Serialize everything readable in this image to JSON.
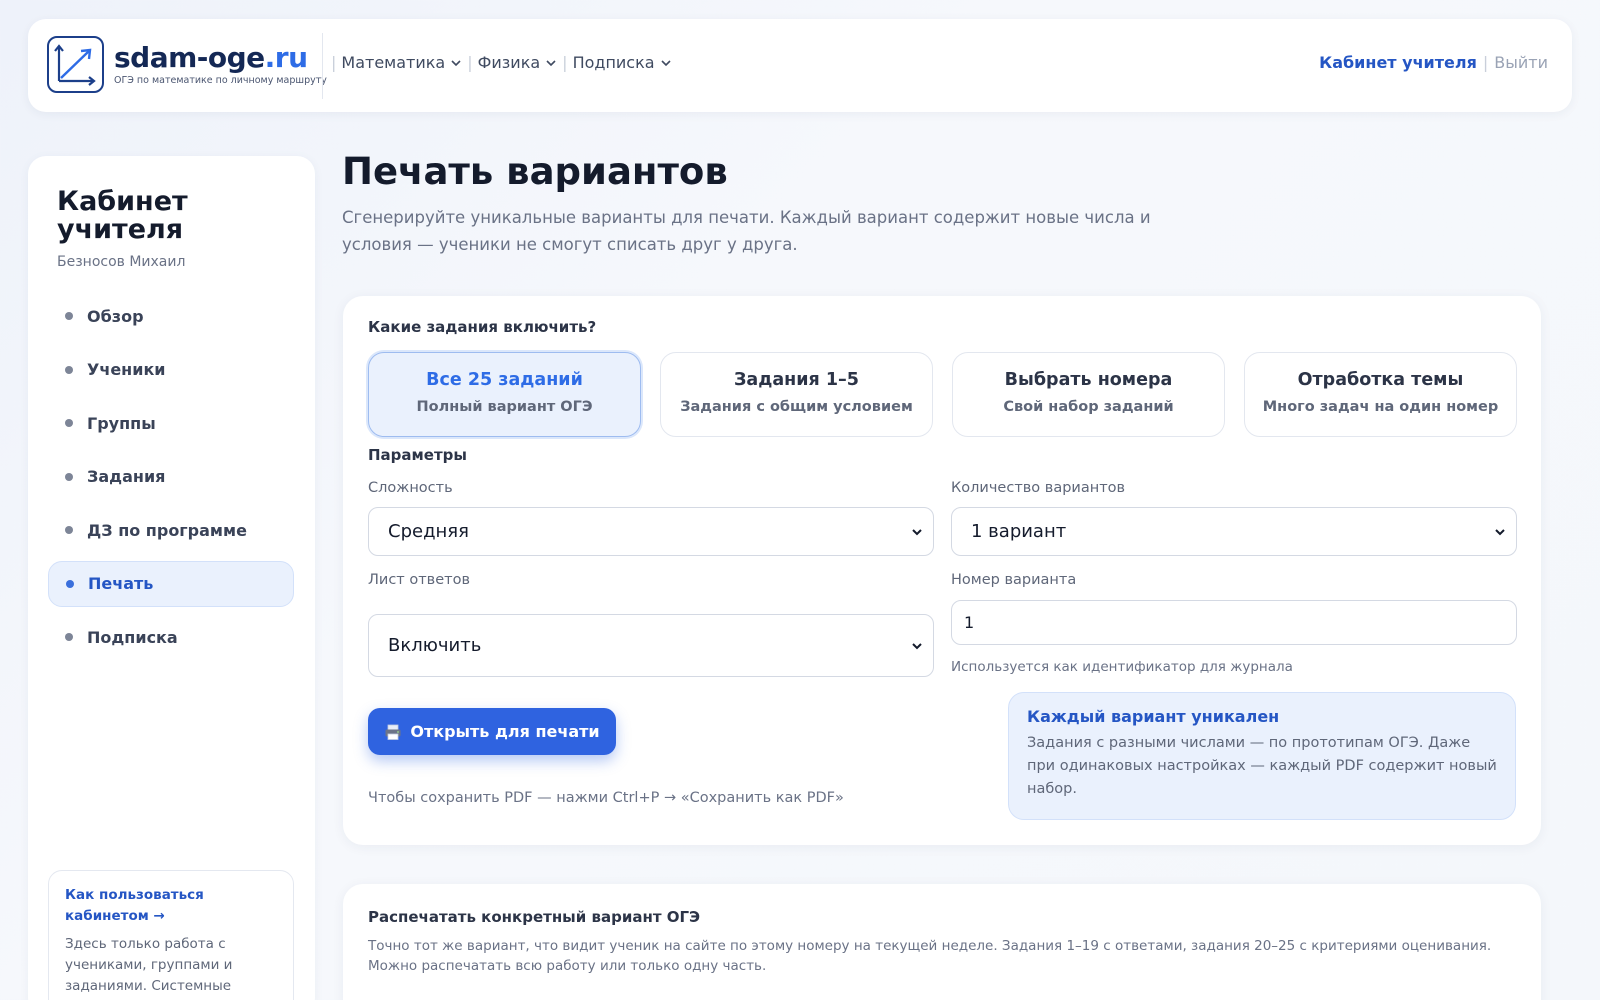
{
  "header": {
    "brand_name": "sdam-oge",
    "brand_tld": ".ru",
    "brand_sub": "ОГЭ по математике по личному маршруту",
    "nav": [
      {
        "label": "Математика"
      },
      {
        "label": "Физика"
      },
      {
        "label": "Подписка"
      }
    ],
    "cabinet_label": "Кабинет учителя",
    "logout_label": "Выйти",
    "accent_color": "#2556c4"
  },
  "sidebar": {
    "title": "Кабинет учителя",
    "user": "Безносов Михаил",
    "items": [
      {
        "label": "Обзор"
      },
      {
        "label": "Ученики"
      },
      {
        "label": "Группы"
      },
      {
        "label": "Задания"
      },
      {
        "label": "ДЗ по программе"
      },
      {
        "label": "Печать",
        "active": true
      },
      {
        "label": "Подписка"
      }
    ],
    "help": {
      "link": "Как пользоваться кабинетом →",
      "text": "Здесь только работа с учениками, группами и заданиями. Системные"
    }
  },
  "main": {
    "title": "Печать вариантов",
    "description": "Сгенерируйте уникальные варианты для печати. Каждый вариант содержит новые числа и условия — ученики не смогут списать друг у друга.",
    "tasks_label": "Какие задания включить?",
    "modes": [
      {
        "title": "Все 25 заданий",
        "sub": "Полный вариант ОГЭ",
        "active": true
      },
      {
        "title": "Задания 1–5",
        "sub": "Задания с общим условием"
      },
      {
        "title": "Выбрать номера",
        "sub": "Свой набор заданий"
      },
      {
        "title": "Отработка темы",
        "sub": "Много задач на один номер"
      }
    ],
    "params_label": "Параметры",
    "difficulty": {
      "label": "Сложность",
      "value": "Средняя"
    },
    "variants_count": {
      "label": "Количество вариантов",
      "value": "1 вариант"
    },
    "answer_sheet": {
      "label": "Лист ответов",
      "value": "Включить"
    },
    "variant_number": {
      "label": "Номер варианта",
      "value": "1",
      "hint": "Используется как идентификатор для журнала"
    },
    "print_button": "Открыть для печати",
    "pdf_hint": "Чтобы сохранить PDF — нажми Ctrl+P → «Сохранить как PDF»",
    "info": {
      "title": "Каждый вариант уникален",
      "text": "Задания с разными числами — по прототипам ОГЭ. Даже при одинаковых настройках — каждый PDF содержит новый набор."
    },
    "specific": {
      "title": "Распечатать конкретный вариант ОГЭ",
      "text": "Точно тот же вариант, что видит ученик на сайте по этому номеру на текущей неделе. Задания 1–19 с ответами, задания 20–25 с критериями оценивания. Можно распечатать всю работу или только одну часть."
    }
  }
}
